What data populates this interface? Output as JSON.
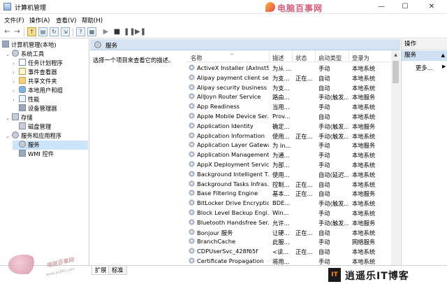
{
  "window": {
    "title": "计算机管理",
    "minimize": "—",
    "maximize": "☐",
    "close": "✕"
  },
  "watermark_top": {
    "name": "电脑百事网",
    "url": "www.PC841.COM"
  },
  "menu": [
    "文件(F)",
    "操作(A)",
    "查看(V)",
    "帮助(H)"
  ],
  "toolbar_icons": [
    "back-icon",
    "forward-icon",
    "up-folder-icon",
    "show-hide-tree-icon",
    "refresh-icon",
    "export-icon",
    "properties-icon",
    "help-icon",
    "start-service-icon",
    "stop-service-icon",
    "pause-service-icon",
    "restart-service-icon"
  ],
  "tree": {
    "root": "计算机管理(本地)",
    "system_tools": "系统工具",
    "task_scheduler": "任务计划程序",
    "event_viewer": "事件查看器",
    "shared_folders": "共享文件夹",
    "local_users": "本地用户和组",
    "performance": "性能",
    "device_manager": "设备管理器",
    "storage": "存储",
    "disk_management": "磁盘管理",
    "services_apps": "服务和应用程序",
    "services": "服务",
    "wmi": "WMI 控件"
  },
  "center": {
    "header": "服务",
    "description": "选择一个项目来查看它的描述。",
    "columns": {
      "name": "名称",
      "desc": "描述",
      "status": "状态",
      "startup": "启动类型",
      "logon": "登录为"
    },
    "rows": [
      {
        "name": "ActiveX Installer (AxInstSV)",
        "desc": "为从 ...",
        "status": "",
        "startup": "手动",
        "logon": "本地系统"
      },
      {
        "name": "Alipay payment client sec...",
        "desc": "为支...",
        "status": "正在...",
        "startup": "自动",
        "logon": "本地系统"
      },
      {
        "name": "Alipay security business s...",
        "desc": "为支...",
        "status": "",
        "startup": "自动",
        "logon": "本地系统"
      },
      {
        "name": "AllJoyn Router Service",
        "desc": "路由...",
        "status": "",
        "startup": "手动(触发...",
        "logon": "本地服务"
      },
      {
        "name": "App Readiness",
        "desc": "当用...",
        "status": "",
        "startup": "手动",
        "logon": "本地系统"
      },
      {
        "name": "Apple Mobile Device Ser...",
        "desc": "Prov...",
        "status": "",
        "startup": "自动",
        "logon": "本地系统"
      },
      {
        "name": "Application Identity",
        "desc": "确定...",
        "status": "",
        "startup": "手动(触发...",
        "logon": "本地服务"
      },
      {
        "name": "Application Information",
        "desc": "使用...",
        "status": "正在...",
        "startup": "手动(触发...",
        "logon": "本地系统"
      },
      {
        "name": "Application Layer Gatewa...",
        "desc": "为 In...",
        "status": "",
        "startup": "手动",
        "logon": "本地服务"
      },
      {
        "name": "Application Management",
        "desc": "为通...",
        "status": "",
        "startup": "手动",
        "logon": "本地系统"
      },
      {
        "name": "AppX Deployment Servic...",
        "desc": "为部...",
        "status": "",
        "startup": "手动",
        "logon": "本地系统"
      },
      {
        "name": "Background Intelligent T...",
        "desc": "使用...",
        "status": "",
        "startup": "自动(延迟...",
        "logon": "本地系统"
      },
      {
        "name": "Background Tasks Infras...",
        "desc": "控制...",
        "status": "正在...",
        "startup": "自动",
        "logon": "本地系统"
      },
      {
        "name": "Base Filtering Engine",
        "desc": "基本...",
        "status": "正在...",
        "startup": "自动",
        "logon": "本地服务"
      },
      {
        "name": "BitLocker Drive Encryptio...",
        "desc": "BDE...",
        "status": "",
        "startup": "手动(触发...",
        "logon": "本地系统"
      },
      {
        "name": "Block Level Backup Engi...",
        "desc": "Win...",
        "status": "",
        "startup": "手动",
        "logon": "本地系统"
      },
      {
        "name": "Bluetooth Handsfree Ser...",
        "desc": "允许...",
        "status": "",
        "startup": "手动(触发...",
        "logon": "本地服务"
      },
      {
        "name": "Bonjour 服务",
        "desc": "让硬...",
        "status": "正在...",
        "startup": "自动",
        "logon": "本地系统"
      },
      {
        "name": "BranchCache",
        "desc": "此服...",
        "status": "",
        "startup": "手动",
        "logon": "网络服务"
      },
      {
        "name": "CDPUserSvc_428f65f",
        "desc": "<读...",
        "status": "正在...",
        "startup": "自动",
        "logon": "本地系统"
      },
      {
        "name": "Certificate Propagation",
        "desc": "将用...",
        "status": "",
        "startup": "手动",
        "logon": "本地系统"
      }
    ]
  },
  "actions": {
    "title": "操作",
    "section": "服务",
    "more": "更多..."
  },
  "tabs": {
    "extended": "扩展",
    "standard": "标准"
  },
  "watermark_bottom": {
    "stamp": "电脑百事网",
    "stamp_url": "www.pc841.com",
    "brand_it": "IT",
    "brand": "逍遥乐IT博客"
  }
}
